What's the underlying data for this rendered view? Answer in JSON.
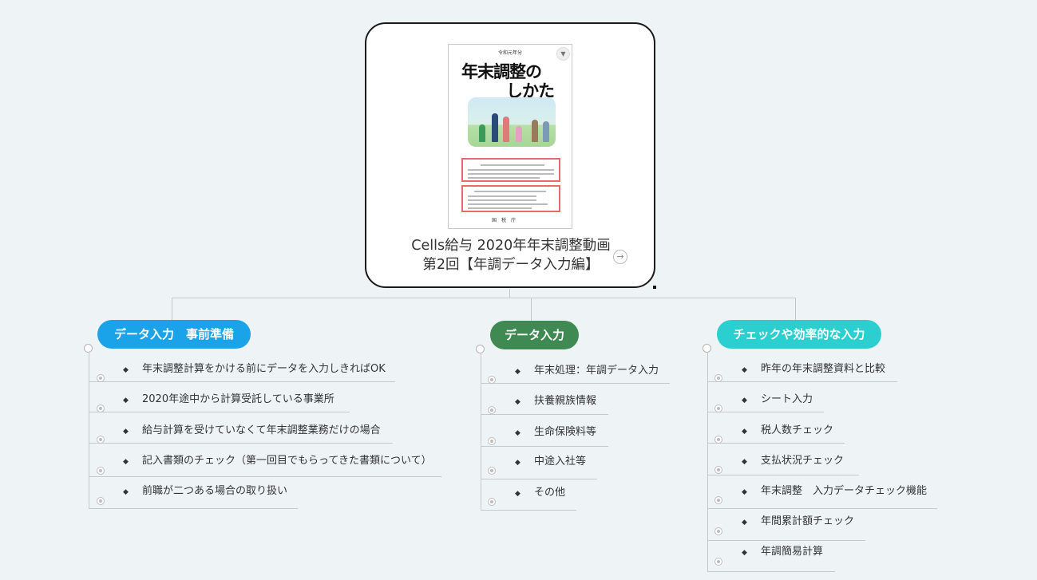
{
  "central": {
    "title_line1": "Cells給与 2020年年末調整動画",
    "title_line2": "第2回【年調データ入力編】",
    "cover": {
      "small_text": "令和元年分",
      "title_line1": "年末調整の",
      "title_line2": "しかた",
      "publisher": "国　税　庁"
    }
  },
  "branches": [
    {
      "label": "データ入力　事前準備",
      "color": "#1aa3e8",
      "items": [
        "年末調整計算をかける前にデータを入力しきればOK",
        "2020年途中から計算受託している事業所",
        "給与計算を受けていなくて年末調整業務だけの場合",
        "記入書類のチェック（第一回目でもらってきた書類について）",
        "前職が二つある場合の取り扱い"
      ]
    },
    {
      "label": "データ入力",
      "color": "#3f8a52",
      "items": [
        "年末処理：年調データ入力",
        "扶養親族情報",
        "生命保険料等",
        "中途入社等",
        "その他"
      ]
    },
    {
      "label": "チェックや効率的な入力",
      "color": "#2ccfcf",
      "items": [
        "昨年の年末調整資料と比較",
        "シート入力",
        "税人数チェック",
        "支払状況チェック",
        "年末調整　入力データチェック機能",
        "年間累計額チェック",
        "年調簡易計算"
      ]
    }
  ],
  "icons": {
    "bullet": "diamond-icon",
    "arrow": "arrow-right-icon",
    "dropdown": "chevron-down-icon"
  }
}
